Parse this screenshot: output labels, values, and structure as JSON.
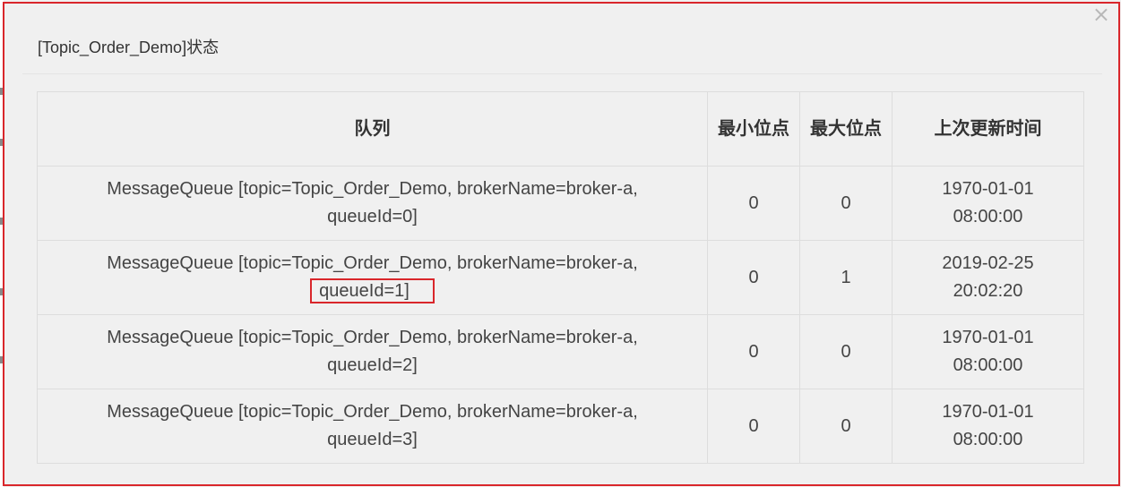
{
  "dialog": {
    "title": "[Topic_Order_Demo]状态",
    "close_symbol": "×"
  },
  "table": {
    "headers": {
      "queue": "队列",
      "min_offset": "最小位点",
      "max_offset": "最大位点",
      "last_update": "上次更新时间"
    },
    "rows": [
      {
        "queue_line1": "MessageQueue [topic=Topic_Order_Demo, brokerName=broker-a,",
        "queue_line2": "queueId=0]",
        "min_offset": "0",
        "max_offset": "0",
        "date": "1970-01-01",
        "time": "08:00:00"
      },
      {
        "queue_line1": "MessageQueue [topic=Topic_Order_Demo, brokerName=broker-a,",
        "queue_line2": "queueId=1]",
        "min_offset": "0",
        "max_offset": "1",
        "date": "2019-02-25",
        "time": "20:02:20"
      },
      {
        "queue_line1": "MessageQueue [topic=Topic_Order_Demo, brokerName=broker-a,",
        "queue_line2": "queueId=2]",
        "min_offset": "0",
        "max_offset": "0",
        "date": "1970-01-01",
        "time": "08:00:00"
      },
      {
        "queue_line1": "MessageQueue [topic=Topic_Order_Demo, brokerName=broker-a,",
        "queue_line2": "queueId=3]",
        "min_offset": "0",
        "max_offset": "0",
        "date": "1970-01-01",
        "time": "08:00:00"
      }
    ]
  },
  "colors": {
    "highlight": "#d9262b",
    "background": "#f0f0f0",
    "border": "#dddddd"
  }
}
